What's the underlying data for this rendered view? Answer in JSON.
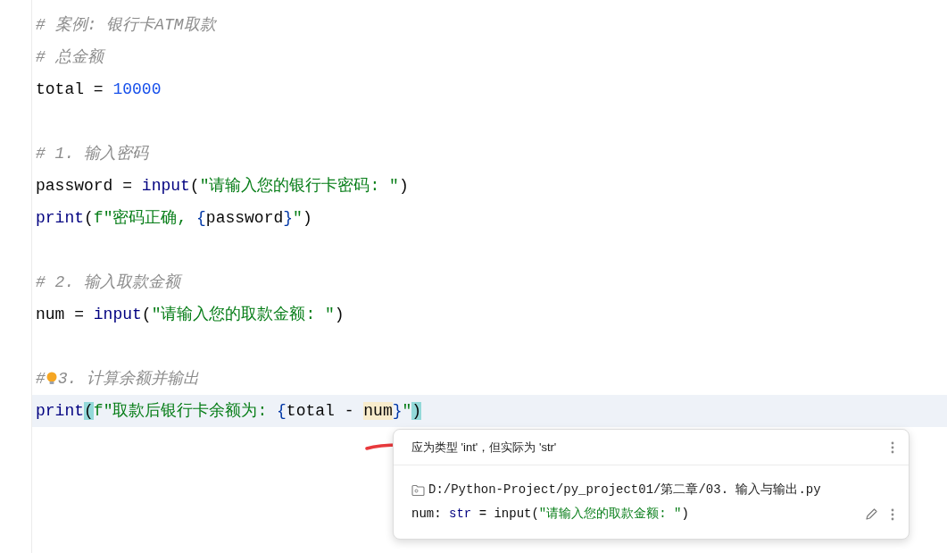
{
  "editor": {
    "lines": [
      {
        "kind": "code",
        "current": false,
        "bulb": false,
        "tokens": [
          {
            "text": "# 案例: 银行卡ATM取款",
            "kind": "comment"
          }
        ]
      },
      {
        "kind": "code",
        "current": false,
        "bulb": false,
        "tokens": [
          {
            "text": "# 总金额",
            "kind": "comment"
          }
        ]
      },
      {
        "kind": "code",
        "current": false,
        "bulb": false,
        "tokens": [
          {
            "text": "total = ",
            "kind": "name"
          },
          {
            "text": "10000",
            "kind": "number"
          }
        ]
      },
      {
        "kind": "blank"
      },
      {
        "kind": "code",
        "current": false,
        "bulb": false,
        "tokens": [
          {
            "text": "# 1. 输入密码",
            "kind": "comment"
          }
        ]
      },
      {
        "kind": "code",
        "current": false,
        "bulb": false,
        "tokens": [
          {
            "text": "password = ",
            "kind": "name"
          },
          {
            "text": "input",
            "kind": "builtin"
          },
          {
            "text": "(",
            "kind": "name"
          },
          {
            "text": "\"请输入您的银行卡密码: \"",
            "kind": "string"
          },
          {
            "text": ")",
            "kind": "name"
          }
        ]
      },
      {
        "kind": "code",
        "current": false,
        "bulb": false,
        "tokens": [
          {
            "text": "print",
            "kind": "builtin"
          },
          {
            "text": "(",
            "kind": "name"
          },
          {
            "text": "f\"密码正确, ",
            "kind": "string"
          },
          {
            "text": "{",
            "kind": "brace"
          },
          {
            "text": "password",
            "kind": "name"
          },
          {
            "text": "}",
            "kind": "brace"
          },
          {
            "text": "\"",
            "kind": "string"
          },
          {
            "text": ")",
            "kind": "name"
          }
        ]
      },
      {
        "kind": "blank"
      },
      {
        "kind": "code",
        "current": false,
        "bulb": false,
        "tokens": [
          {
            "text": "# 2. 输入取款金额",
            "kind": "comment"
          }
        ]
      },
      {
        "kind": "code",
        "current": false,
        "bulb": false,
        "tokens": [
          {
            "text": "num = ",
            "kind": "name"
          },
          {
            "text": "input",
            "kind": "builtin"
          },
          {
            "text": "(",
            "kind": "name"
          },
          {
            "text": "\"请输入您的取款金额: \"",
            "kind": "string"
          },
          {
            "text": ")",
            "kind": "name"
          }
        ]
      },
      {
        "kind": "blank"
      },
      {
        "kind": "code",
        "current": false,
        "bulb": true,
        "tokens": [
          {
            "text": "#",
            "kind": "comment"
          },
          {
            "text": "3. 计算余额并输出",
            "kind": "comment"
          }
        ]
      },
      {
        "kind": "code",
        "current": true,
        "bulb": false,
        "tokens": [
          {
            "text": "print",
            "kind": "builtin"
          },
          {
            "text": "(",
            "kind": "match"
          },
          {
            "text": "f\"取款后银行卡余额为: ",
            "kind": "string"
          },
          {
            "text": "{",
            "kind": "brace"
          },
          {
            "text": "total - ",
            "kind": "name"
          },
          {
            "text": "num",
            "kind": "usage"
          },
          {
            "text": "}",
            "kind": "brace"
          },
          {
            "text": "\"",
            "kind": "string"
          },
          {
            "text": ")",
            "kind": "match"
          }
        ]
      }
    ]
  },
  "popup": {
    "message": "应为类型 'int'，但实际为 'str'",
    "path": "D:/Python-Project/py_project01/第二章/03. 输入与输出.py",
    "code": [
      {
        "text": "num: ",
        "kind": "name"
      },
      {
        "text": "str",
        "kind": "builtin"
      },
      {
        "text": " = input(",
        "kind": "name"
      },
      {
        "text": "\"请输入您的取款金额: \"",
        "kind": "string"
      },
      {
        "text": ")",
        "kind": "name"
      }
    ]
  }
}
